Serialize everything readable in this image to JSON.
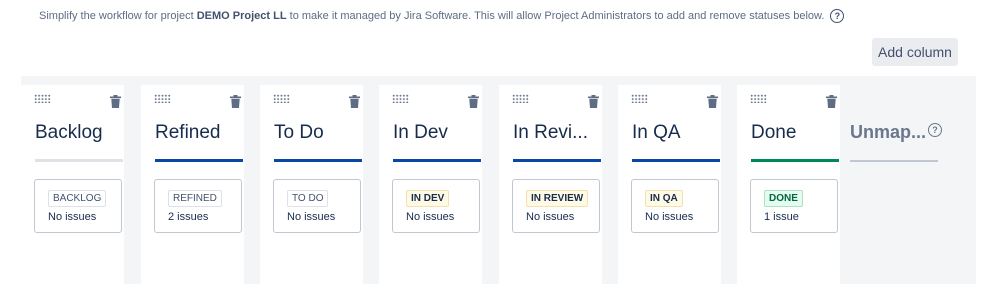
{
  "info": {
    "text_before": "Simplify the workflow for project ",
    "project_name": "DEMO Project LL",
    "text_after": " to make it managed by Jira Software. This will allow Project Administrators to add and remove statuses below.",
    "help_glyph": "?"
  },
  "toolbar": {
    "add_column_label": "Add column"
  },
  "colors": {
    "todo_bar": "#dfe1e6",
    "blue_bar": "#0747a6",
    "done_bar": "#00875a"
  },
  "columns": [
    {
      "title": "Backlog",
      "bar": "todo",
      "status": "BACKLOG",
      "category": "todo",
      "issues": "No issues"
    },
    {
      "title": "Refined",
      "bar": "blue",
      "status": "REFINED",
      "category": "todo",
      "issues": "2 issues"
    },
    {
      "title": "To Do",
      "bar": "blue",
      "status": "TO DO",
      "category": "todo",
      "issues": "No issues"
    },
    {
      "title": "In Dev",
      "bar": "blue",
      "status": "IN DEV",
      "category": "prog",
      "issues": "No issues"
    },
    {
      "title": "In Revi...",
      "bar": "blue",
      "status": "IN REVIEW",
      "category": "prog",
      "issues": "No issues"
    },
    {
      "title": "In QA",
      "bar": "blue",
      "status": "IN QA",
      "category": "prog",
      "issues": "No issues"
    },
    {
      "title": "Done",
      "bar": "done",
      "status": "DONE",
      "category": "done",
      "issues": "1 issue"
    }
  ],
  "unmapped": {
    "title": "Unmap...",
    "help_glyph": "?"
  },
  "icons": {
    "drag": "drag-handle-icon",
    "delete": "trash-icon",
    "help": "question-circle-icon"
  }
}
